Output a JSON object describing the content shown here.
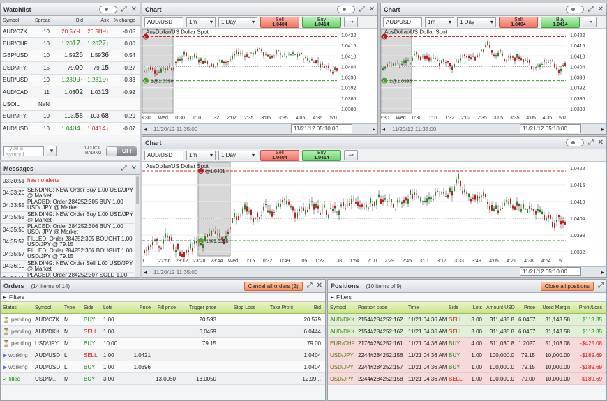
{
  "watchlist": {
    "title": "Watchlist",
    "columns": [
      "Symbol",
      "Spread",
      "Bid",
      "Ask",
      "% change"
    ],
    "rows": [
      {
        "symbol": "AUD/CZK",
        "spread": "10",
        "bid_a": "20.5",
        "bid_b": "79",
        "bid_dir": "↓",
        "bid_color": "#d21a1a",
        "ask_a": "20.5",
        "ask_b": "89",
        "ask_dir": "↓",
        "ask_color": "#d21a1a",
        "chg": "-0.05"
      },
      {
        "symbol": "EUR/CHF",
        "spread": "10",
        "bid_a": "1.20",
        "bid_b": "17",
        "bid_dir": "↑",
        "bid_color": "#1b8a1b",
        "ask_a": "1.20",
        "ask_b": "27",
        "ask_dir": "↑",
        "ask_color": "#1b8a1b",
        "chg": "0.00"
      },
      {
        "symbol": "GBP/USD",
        "spread": "10",
        "bid_a": "1.59",
        "bid_b": "26",
        "bid_dir": "",
        "bid_color": "#222",
        "ask_a": "1.59",
        "ask_b": "36",
        "ask_dir": "",
        "ask_color": "#222",
        "chg": "0.54"
      },
      {
        "symbol": "USD/JPY",
        "spread": "15",
        "bid_a": "79.",
        "bid_b": "00",
        "bid_dir": "",
        "bid_color": "#222",
        "ask_a": "79.",
        "ask_b": "15",
        "ask_dir": "",
        "ask_color": "#222",
        "chg": "-0.27"
      },
      {
        "symbol": "EUR/USD",
        "spread": "10",
        "bid_a": "1.28",
        "bid_b": "09",
        "bid_dir": "↑",
        "bid_color": "#1b8a1b",
        "ask_a": "1.28",
        "ask_b": "19",
        "ask_dir": "↑",
        "ask_color": "#1b8a1b",
        "chg": "-0.33"
      },
      {
        "symbol": "AUD/CAD",
        "spread": "11",
        "bid_a": "1.03",
        "bid_b": "02",
        "bid_dir": "",
        "bid_color": "#222",
        "ask_a": "1.03",
        "ask_b": "13",
        "ask_dir": "",
        "ask_color": "#222",
        "chg": "-0.92"
      },
      {
        "symbol": "USOIL",
        "spread": "NaN",
        "bid_a": "",
        "bid_b": "",
        "bid_dir": "",
        "bid_color": "#222",
        "ask_a": "",
        "ask_b": "",
        "ask_dir": "",
        "ask_color": "#222",
        "chg": ""
      },
      {
        "symbol": "EUR/JPY",
        "spread": "10",
        "bid_a": "103.",
        "bid_b": "58",
        "bid_dir": "",
        "bid_color": "#222",
        "ask_a": "103.",
        "ask_b": "68",
        "ask_dir": "",
        "ask_color": "#222",
        "chg": "0.29"
      },
      {
        "symbol": "AUD/USD",
        "spread": "10",
        "bid_a": "1.04",
        "bid_b": "04",
        "bid_dir": "↑",
        "bid_color": "#1b8a1b",
        "ask_a": "1.04",
        "ask_b": "14",
        "ask_dir": "↓",
        "ask_color": "#d21a1a",
        "chg": "-0.07"
      }
    ],
    "symbol_placeholder": "Type a symbol",
    "one_click": "1-CLICK TRADING",
    "toggle": "OFF"
  },
  "messages": {
    "title": "Messages",
    "rows": [
      {
        "time": "03:30:51",
        "text": "has no alerts",
        "color": "#d21a1a"
      },
      {
        "time": "04:33:26",
        "text": "SENDING: NEW Order Buy 1.00 USD/JPY @ Market",
        "color": "#222"
      },
      {
        "time": "04:33:55",
        "text": "PLACED: Order 284252:305 BUY 1.00 USD/ JPY @ Market",
        "color": "#222"
      },
      {
        "time": "04:35:55",
        "text": "SENDING: NEW Order Buy 1.00 USD/JPY @ Market",
        "color": "#222"
      },
      {
        "time": "04:35:56",
        "text": "PLACED: Order 284252:306 BUY 1.00 USD/ JPY @ Market",
        "color": "#222"
      },
      {
        "time": "04:35:57",
        "text": "FILLED: Order 284252:305 BOUGHT 1.00 USD/JPY @ 79.15",
        "color": "#222"
      },
      {
        "time": "04:35:57",
        "text": "FILLED: Order 284252:306 BOUGHT 1.00 USD/JPY @ 79.15",
        "color": "#222"
      },
      {
        "time": "04:36:10",
        "text": "SENDING: NEW Order Sell 1.00 USD/JPY @ Market",
        "color": "#222"
      },
      {
        "time": "04:36:11",
        "text": "PLACED: Order 284252:307 SOLD 1.00 USD",
        "color": "#222"
      }
    ]
  },
  "chart1": {
    "title": "Chart",
    "symbol": "AUD/USD",
    "interval": "1m",
    "range": "1 Day",
    "sell_label": "Sell",
    "sell_price": "1.0404",
    "buy_label": "Buy",
    "buy_price": "1.0414",
    "chart_title": "AusDollar/US Dollar Spot",
    "l_label": "1@1.0396",
    "nav_left": "11/20/12 11:35:00",
    "nav_right": "11/21/12 05:10:00",
    "xticks": [
      "3:30",
      "Wed",
      "0:30",
      "1:01",
      "1:32",
      "2:02",
      "2:35",
      "3:05",
      "3:35",
      "4:05",
      "4:36",
      "5:0"
    ],
    "yticks": [
      "1.0422",
      "1.0416",
      "1.0410",
      "1.0404",
      "1.0398",
      "1.0392",
      "1.0386",
      "1.0380"
    ]
  },
  "chart2": {
    "title": "Chart",
    "symbol": "AUD/USD",
    "interval": "1m",
    "range": "1 Day",
    "sell_label": "Sell",
    "sell_price": "1.0404",
    "buy_label": "Buy",
    "buy_price": "1.0414",
    "chart_title": "AusDollar/US Dollar Spot",
    "l_label": "1@1.0396",
    "nav_left": "11/20/12 11:35:00",
    "nav_right": "11/21/12 05:10:00",
    "xticks": [
      "3:30",
      "Wed",
      "0:30",
      "1:01",
      "1:32",
      "2:02",
      "2:35",
      "3:05",
      "3:35",
      "4:05",
      "4:36",
      "5:0"
    ],
    "yticks": [
      "1.0422",
      "1.0416",
      "1.0410",
      "1.0404",
      "1.0398",
      "1.0392",
      "1.0386",
      "1.0380"
    ]
  },
  "chart3": {
    "title": "Chart",
    "symbol": "AUD/USD",
    "interval": "1m",
    "range": "1 Day",
    "sell_label": "Sell",
    "sell_price": "1.0404",
    "buy_label": "Buy",
    "buy_price": "1.0414",
    "chart_title": "AusDollar/US Dollar Spot",
    "s_label": "@1.0421",
    "l_label": "1@1.0396",
    "nav_left": "11/20/12 11:35:00",
    "nav_right": "11/21/12 05:10:00",
    "xticks": [
      "0",
      "22:56",
      "23:12",
      "23:28",
      "23:44",
      "Wed",
      "0:16",
      "0:32",
      "0:49",
      "1:05",
      "1:22",
      "1:38",
      "1:54",
      "2:10",
      "2:29",
      "2:45",
      "3:01",
      "3:17",
      "3:33",
      "3:49",
      "4:05",
      "4:21",
      "4:38",
      "4:54",
      "5:"
    ],
    "yticks": [
      "1.0422",
      "1.0416",
      "1.0410",
      "1.0404",
      "1.0398",
      "1.0392"
    ]
  },
  "orders": {
    "title": "Orders",
    "count": "(14 items of 14)",
    "cancel_all": "Cancel all orders (2)",
    "filters": "Filters",
    "columns": [
      "Status",
      "Symbol",
      "Type",
      "Side",
      "Lots",
      "Price",
      "Fill price",
      "Trigger price",
      "Stop Loss",
      "Take Profit",
      "Bid"
    ],
    "rows": [
      {
        "status": "pending",
        "icon": "⏳",
        "icolor": "#c9891a",
        "symbol": "AUD/CZK",
        "type": "M",
        "side": "BUY",
        "lots": "1.00",
        "price": "",
        "fill": "",
        "trigger": "20.593",
        "stop": "",
        "take": "",
        "bid": "20.579"
      },
      {
        "status": "pending",
        "icon": "⏳",
        "icolor": "#c9891a",
        "symbol": "AUD/DKK",
        "type": "M",
        "side": "SELL",
        "lots": "1.00",
        "price": "",
        "fill": "",
        "trigger": "6.0459",
        "stop": "",
        "take": "",
        "bid": "6.0444"
      },
      {
        "status": "pending",
        "icon": "⏳",
        "icolor": "#c9891a",
        "symbol": "USD/JPY",
        "type": "M",
        "side": "BUY",
        "lots": "10.00",
        "price": "",
        "fill": "",
        "trigger": "79.15",
        "stop": "",
        "take": "",
        "bid": "79.00"
      },
      {
        "status": "working",
        "icon": "▶",
        "icolor": "#5a6fd0",
        "symbol": "AUD/USD",
        "type": "L",
        "side": "SELL",
        "lots": "1.00",
        "price": "1.0421",
        "fill": "",
        "trigger": "",
        "stop": "",
        "take": "",
        "bid": "1.0404"
      },
      {
        "status": "working",
        "icon": "▶",
        "icolor": "#5a6fd0",
        "symbol": "AUD/USD",
        "type": "L",
        "side": "BUY",
        "lots": "1.00",
        "price": "1.0396",
        "fill": "",
        "trigger": "",
        "stop": "",
        "take": "",
        "bid": "1.0404"
      },
      {
        "status": "filled",
        "icon": "✓",
        "icolor": "#1b8a1b",
        "symbol": "USD/M...",
        "type": "M",
        "side": "BUY",
        "lots": "3.00",
        "price": "",
        "fill": "13.0050",
        "trigger": "13.0050",
        "stop": "",
        "take": "",
        "bid": "12.99..."
      }
    ]
  },
  "positions": {
    "title": "Positions",
    "count": "(10 items of 9)",
    "close_all": "Close all positions",
    "filters": "Filters",
    "columns": [
      "Symbol",
      "Position code",
      "Time",
      "Side",
      "Lots",
      "Amount USD",
      "Price",
      "Used Margin",
      "Profit/Loss"
    ],
    "rows": [
      {
        "symbol": "AUD/DKK",
        "code": "2154#284252:162",
        "time": "11/21 04:36 AM",
        "side": "SELL",
        "lots": "3.00",
        "amount": "311,435.8",
        "price": "6.0467",
        "margin": "31,143.58",
        "pl": "$113.35",
        "plcolor": "#1b8a1b",
        "bg": "#dff1d6"
      },
      {
        "symbol": "AUD/DKK",
        "code": "2154#284252:162",
        "time": "11/21 04:36 AM",
        "side": "SELL",
        "lots": "3.00",
        "amount": "311,435.8",
        "price": "6.0467",
        "margin": "31,143.58",
        "pl": "$113.35",
        "plcolor": "#1b8a1b",
        "bg": "#dff1d6"
      },
      {
        "symbol": "EUR/CHF",
        "code": "2176#284252:161",
        "time": "11/21 04:36 AM",
        "side": "BUY",
        "lots": "4.00",
        "amount": "511,030.8",
        "price": "1.2027",
        "margin": "51,103.08",
        "pl": "-$425.08",
        "plcolor": "#d21a1a",
        "bg": "#f6d9d9"
      },
      {
        "symbol": "USD/JPY",
        "code": "2244#284252:156",
        "time": "11/21 04:36 AM",
        "side": "BUY",
        "lots": "1.00",
        "amount": "100,000.0",
        "price": "79.15",
        "margin": "10,000.00",
        "pl": "-$189.69",
        "plcolor": "#d21a1a",
        "bg": "#f6d9d9"
      },
      {
        "symbol": "USD/JPY",
        "code": "2244#284252:157",
        "time": "11/21 04:36 AM",
        "side": "BUY",
        "lots": "1.00",
        "amount": "100,000.0",
        "price": "79.15",
        "margin": "10,000.00",
        "pl": "-$189.69",
        "plcolor": "#d21a1a",
        "bg": "#f6d9d9"
      },
      {
        "symbol": "USD/JPY",
        "code": "2244#284252:158",
        "time": "11/21 04:36 AM",
        "side": "SELL",
        "lots": "1.00",
        "amount": "100,000.0",
        "price": "79.00",
        "margin": "10,000.00",
        "pl": "-$189.69",
        "plcolor": "#d21a1a",
        "bg": "#f6d9d9"
      }
    ]
  }
}
